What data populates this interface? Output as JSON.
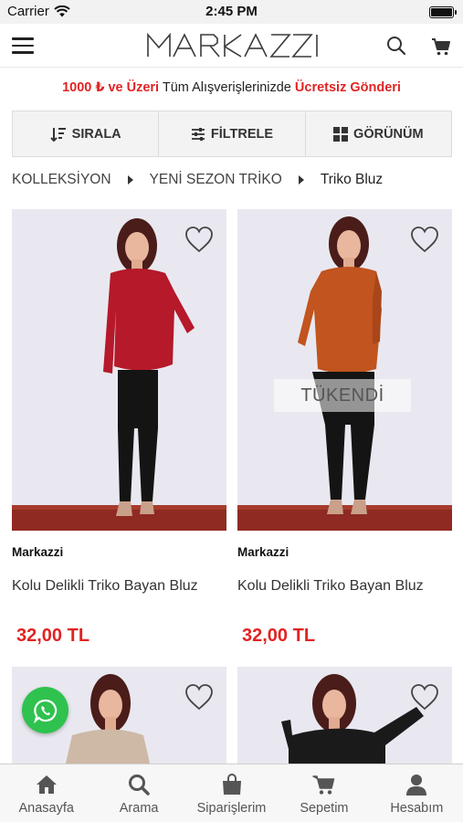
{
  "status_bar": {
    "carrier": "Carrier",
    "time": "2:45 PM"
  },
  "header": {
    "logo_text": "MARKAZZI",
    "menu_icon": "hamburger-icon",
    "search_icon": "search-icon",
    "cart_icon": "cart-icon"
  },
  "promo": {
    "part1": "1000 ₺ ve Üzeri",
    "part2": " Tüm Alışverişlerinizde ",
    "part3": "Ücretsiz Gönderi",
    "accent": "#e02424"
  },
  "toolbar": {
    "sort": "SIRALA",
    "filter": "FİLTRELE",
    "view": "GÖRÜNÜM"
  },
  "breadcrumb": {
    "items": [
      "KOLLEKSİYON",
      "YENİ SEZON TRİKO",
      "Triko Bluz"
    ]
  },
  "products": [
    {
      "brand": "Markazzi",
      "name": "Kolu Delikli Triko Bayan Bluz",
      "price": "32,00 TL",
      "color": "#b5192a",
      "sold_out": ""
    },
    {
      "brand": "Markazzi",
      "name": "Kolu Delikli Triko Bayan Bluz",
      "price": "32,00 TL",
      "color": "#c1541f",
      "sold_out": "TÜKENDİ"
    },
    {
      "color": "#cdb9a6"
    },
    {
      "color": "#1a1a1a"
    }
  ],
  "tabbar": {
    "items": [
      {
        "label": "Anasayfa",
        "icon": "home-icon"
      },
      {
        "label": "Arama",
        "icon": "search-icon"
      },
      {
        "label": "Siparişlerim",
        "icon": "bag-icon"
      },
      {
        "label": "Sepetim",
        "icon": "cart-icon"
      },
      {
        "label": "Hesabım",
        "icon": "user-icon"
      }
    ]
  }
}
